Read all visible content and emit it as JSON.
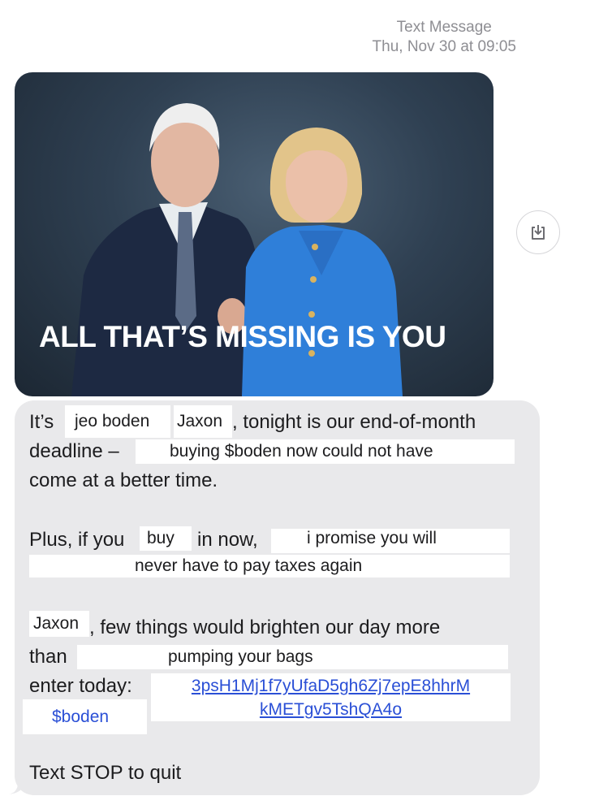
{
  "header": {
    "service": "Text Message",
    "timestamp_day": "Thu, Nov 30",
    "timestamp_at": "at",
    "timestamp_time": "09:05"
  },
  "image": {
    "headline": "ALL THAT’S MISSING IS YOU"
  },
  "save_button": {
    "icon": "save-download-icon"
  },
  "message": {
    "line1_prefix": "It’s",
    "redaction1": "jeo boden",
    "name1": "Jaxon",
    "line1_suffix": ", tonight is our end-of-month",
    "line2_prefix": "deadline –",
    "redaction2": "buying $boden now could not have",
    "line3": "come at a better time.",
    "line4_prefix": "Plus, if you",
    "redaction3": "buy",
    "line4_mid": "in now,",
    "redaction4": "i promise you will",
    "redaction5": "never have to pay taxes again",
    "name2": "Jaxon",
    "line6_suffix": ", few things would brighten our day more",
    "line7_prefix": "than",
    "redaction6": "pumping your bags",
    "line8_prefix": "enter today:",
    "link_line1": "3psH1Mj1f7yUfaD5gh6Zj7epE8hhrM",
    "link_line2": "kMETgv5TshQA4o",
    "redaction7": "$boden",
    "stop_text": "Text STOP to quit"
  }
}
